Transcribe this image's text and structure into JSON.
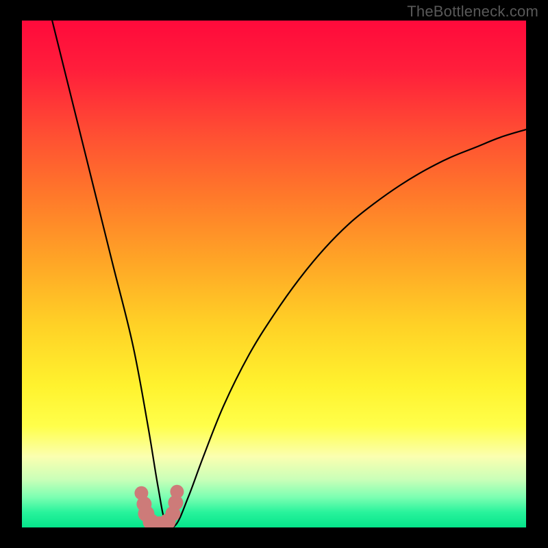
{
  "watermark": {
    "text": "TheBottleneck.com"
  },
  "chart_data": {
    "type": "line",
    "title": "",
    "xlabel": "",
    "ylabel": "",
    "xlim": [
      0,
      100
    ],
    "ylim": [
      0,
      100
    ],
    "grid": false,
    "legend": false,
    "series": [
      {
        "name": "bottleneck-curve",
        "x": [
          6,
          10,
          14,
          18,
          22,
          25,
          27,
          28.5,
          30.5,
          33,
          36,
          40,
          45,
          50,
          55,
          60,
          65,
          70,
          75,
          80,
          85,
          90,
          95,
          100
        ],
        "values": [
          100,
          84,
          68,
          52,
          36,
          20,
          8,
          1,
          0.5,
          6,
          14,
          24,
          34,
          42,
          49,
          55,
          60,
          64,
          67.5,
          70.5,
          73,
          75,
          77,
          78.5
        ]
      }
    ],
    "annotations": [
      {
        "type": "marker-cluster",
        "x": 27.5,
        "y": 3,
        "label": "optimal-zone"
      }
    ],
    "background_gradient": {
      "stops": [
        {
          "pos": 0.0,
          "color": "#ff0a3b"
        },
        {
          "pos": 0.1,
          "color": "#ff1f3b"
        },
        {
          "pos": 0.22,
          "color": "#ff4d33"
        },
        {
          "pos": 0.35,
          "color": "#ff7a2a"
        },
        {
          "pos": 0.48,
          "color": "#ffa726"
        },
        {
          "pos": 0.6,
          "color": "#ffd126"
        },
        {
          "pos": 0.72,
          "color": "#fff22e"
        },
        {
          "pos": 0.8,
          "color": "#ffff4a"
        },
        {
          "pos": 0.86,
          "color": "#fbffb0"
        },
        {
          "pos": 0.905,
          "color": "#caffb8"
        },
        {
          "pos": 0.94,
          "color": "#7dffb2"
        },
        {
          "pos": 0.97,
          "color": "#28f39c"
        },
        {
          "pos": 1.0,
          "color": "#05e48a"
        }
      ]
    }
  }
}
